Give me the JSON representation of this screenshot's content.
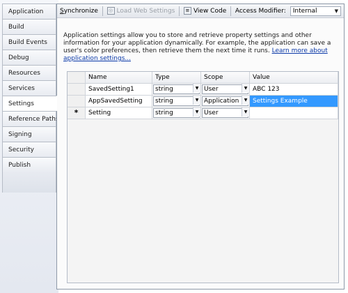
{
  "tabs": [
    {
      "label": "Application"
    },
    {
      "label": "Build"
    },
    {
      "label": "Build Events"
    },
    {
      "label": "Debug"
    },
    {
      "label": "Resources"
    },
    {
      "label": "Services"
    },
    {
      "label": "Settings"
    },
    {
      "label": "Reference Paths"
    },
    {
      "label": "Signing"
    },
    {
      "label": "Security"
    },
    {
      "label": "Publish"
    }
  ],
  "active_tab": "Settings",
  "toolbar": {
    "synchronize": "Synchronize",
    "load_web_settings": "Load Web Settings",
    "view_code": "View Code",
    "access_modifier_label": "Access Modifier:",
    "access_modifier_value": "Internal"
  },
  "description": {
    "text": "Application settings allow you to store and retrieve property settings and other information for your application dynamically. For example, the application can save a user's color preferences, then retrieve them the next time it runs.",
    "link": "Learn more about application settings..."
  },
  "grid": {
    "headers": {
      "name": "Name",
      "type": "Type",
      "scope": "Scope",
      "value": "Value"
    },
    "rows": [
      {
        "marker": "",
        "name": "SavedSetting1",
        "type": "string",
        "scope": "User",
        "value": "ABC 123"
      },
      {
        "marker": "",
        "name": "AppSavedSetting",
        "type": "string",
        "scope": "Application",
        "value": "Settings Example"
      },
      {
        "marker": "*",
        "name": "Setting",
        "type": "string",
        "scope": "User",
        "value": ""
      }
    ]
  },
  "colors": {
    "selection": "#3399ff",
    "link": "#0b39a8"
  }
}
